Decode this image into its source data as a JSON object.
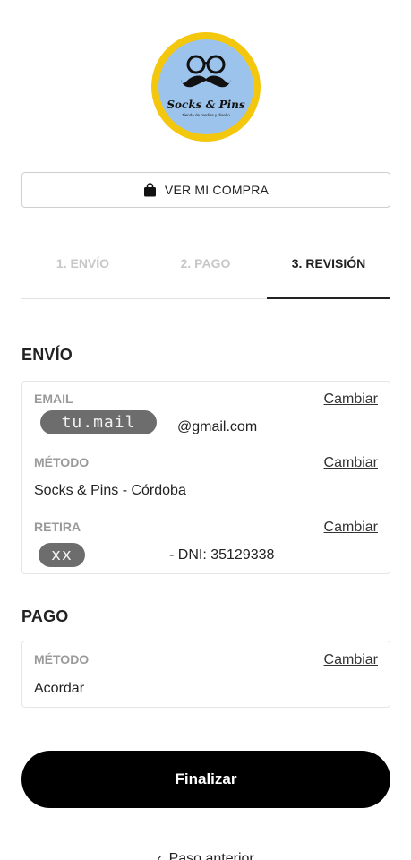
{
  "logo": {
    "title": "Socks & Pins",
    "subtitle": "Tienda de medias y diseño",
    "ring_color": "#f4c70f",
    "bg_color": "#9cc3ec",
    "icon": "glasses-mustache-icon"
  },
  "cart_button": {
    "label": "VER MI COMPRA",
    "icon": "shopping-bag-icon"
  },
  "steps": [
    {
      "label": "1. ENVÍO",
      "active": false
    },
    {
      "label": "2. PAGO",
      "active": false
    },
    {
      "label": "3. REVISIÓN",
      "active": true
    }
  ],
  "shipping": {
    "title": "ENVÍO",
    "email": {
      "label": "EMAIL",
      "masked": "tu.mail",
      "domain": "@gmail.com",
      "change": "Cambiar"
    },
    "method": {
      "label": "MÉTODO",
      "value": "Socks & Pins - Córdoba",
      "change": "Cambiar"
    },
    "pickup": {
      "label": "RETIRA",
      "masked": "xx",
      "dni": "- DNI: 35129338",
      "change": "Cambiar"
    }
  },
  "payment": {
    "title": "PAGO",
    "method": {
      "label": "MÉTODO",
      "value": "Acordar",
      "change": "Cambiar"
    }
  },
  "finish_button": {
    "label": "Finalizar"
  },
  "back_link": {
    "label": "Paso anterior"
  },
  "colors": {
    "primary_button": "#000000",
    "muted_text": "#9a9a9a"
  }
}
